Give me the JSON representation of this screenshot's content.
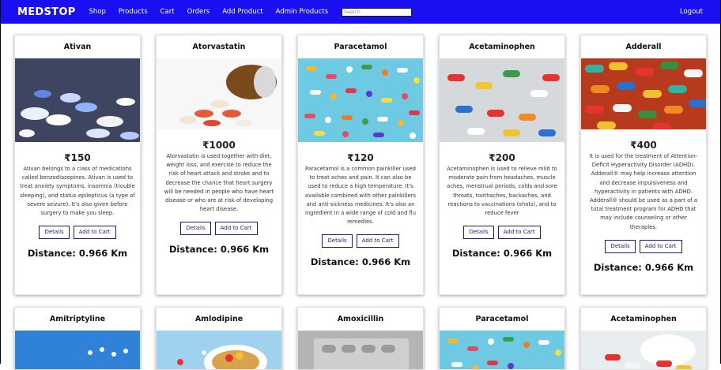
{
  "nav": {
    "brand": "MEDSTOP",
    "links": [
      "Shop",
      "Products",
      "Cart",
      "Orders",
      "Add Product",
      "Admin Products"
    ],
    "search_placeholder": "Search",
    "logout": "Logout"
  },
  "buttons": {
    "details": "Details",
    "add_to_cart": "Add to Cart"
  },
  "products": [
    {
      "name": "Ativan",
      "price": "₹150",
      "description": "Ativan belongs to a class of medications called benzodiazepines. Ativan is used to treat anxiety symptoms, insomnia (trouble sleeping), and status epilepticus (a type of severe seizure). It's also given before surgery to make you sleep.",
      "distance": "Distance: 0.966 Km"
    },
    {
      "name": "Atorvastatin",
      "price": "₹1000",
      "description": "Atorvastatin is used together with diet, weight loss, and exercise to reduce the risk of heart attack and stroke and to decrease the chance that heart surgery will be needed in people who have heart disease or who are at risk of developing heart disease.",
      "distance": "Distance: 0.966 Km"
    },
    {
      "name": "Paracetamol",
      "price": "₹120",
      "description": "Paracetamol is a common painkiller used to treat aches and pain. It can also be used to reduce a high temperature. It's available combined with other painkillers and anti-sickness medicines. It's also an ingredient in a wide range of cold and flu remedies.",
      "distance": "Distance: 0.966 Km"
    },
    {
      "name": "Acetaminophen",
      "price": "₹200",
      "description": "Acetaminophen is used to relieve mild to moderate pain from headaches, muscle aches, menstrual periods, colds and sore throats, toothaches, backaches, and reactions to vaccinations (shots), and to reduce fever",
      "distance": "Distance: 0.966 Km"
    },
    {
      "name": "Adderall",
      "price": "₹400",
      "description": "It is used for the treatment of Attention-Deficit Hyperactivity Disorder (ADHD). Adderall® may help increase attention and decrease impulsiveness and hyperactivity in patients with ADHD. Adderall® should be used as a part of a total treatment program for ADHD that may include counseling or other therapies.",
      "distance": "Distance: 0.966 Km"
    },
    {
      "name": "Amitriptyline"
    },
    {
      "name": "Amlodipine"
    },
    {
      "name": "Amoxicillin"
    },
    {
      "name": "Paracetamol"
    },
    {
      "name": "Acetaminophen"
    }
  ]
}
